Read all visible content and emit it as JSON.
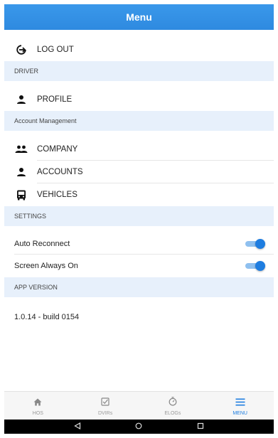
{
  "header": {
    "title": "Menu"
  },
  "logout": {
    "label": "LOG OUT",
    "icon": "logout-icon"
  },
  "sections": {
    "driver": "DRIVER",
    "account_management": "Account Management",
    "settings": "SETTINGS",
    "app_version": "APP VERSION"
  },
  "driver_items": [
    {
      "label": "PROFILE",
      "icon": "person-icon"
    }
  ],
  "account_items": [
    {
      "label": "COMPANY",
      "icon": "group-icon"
    },
    {
      "label": "ACCOUNTS",
      "icon": "person-icon"
    },
    {
      "label": "VEHICLES",
      "icon": "bus-icon"
    }
  ],
  "settings_items": [
    {
      "label": "Auto Reconnect",
      "enabled": true
    },
    {
      "label": "Screen Always On",
      "enabled": true
    }
  ],
  "app_version": {
    "value": "1.0.14 - build 0154"
  },
  "tabs": [
    {
      "label": "HOS",
      "icon": "home-icon",
      "active": false
    },
    {
      "label": "DVIRs",
      "icon": "checkbox-icon",
      "active": false
    },
    {
      "label": "ELOGs",
      "icon": "stopwatch-icon",
      "active": false
    },
    {
      "label": "MENU",
      "icon": "hamburger-icon",
      "active": true
    }
  ],
  "colors": {
    "accent": "#2e8ae0",
    "section_bg": "#e7f0fb",
    "toggle_on": "#1e7de0"
  }
}
